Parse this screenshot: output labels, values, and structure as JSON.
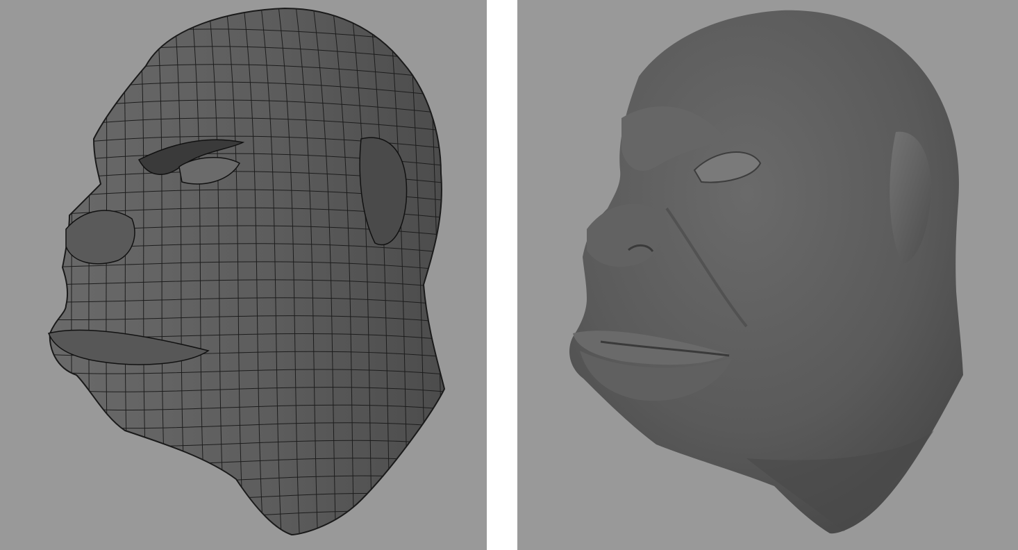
{
  "figure": {
    "panels": [
      {
        "id": "wireframe",
        "subject": "head-model-wireframe"
      },
      {
        "id": "smooth",
        "subject": "head-model-smooth"
      }
    ]
  },
  "colors": {
    "viewport_background": "#999999",
    "gutter": "#ffffff",
    "mesh_fill": "#5e5e5e",
    "mesh_edges": "#1c1c1c",
    "smooth_fill": "#5b5b5b"
  }
}
